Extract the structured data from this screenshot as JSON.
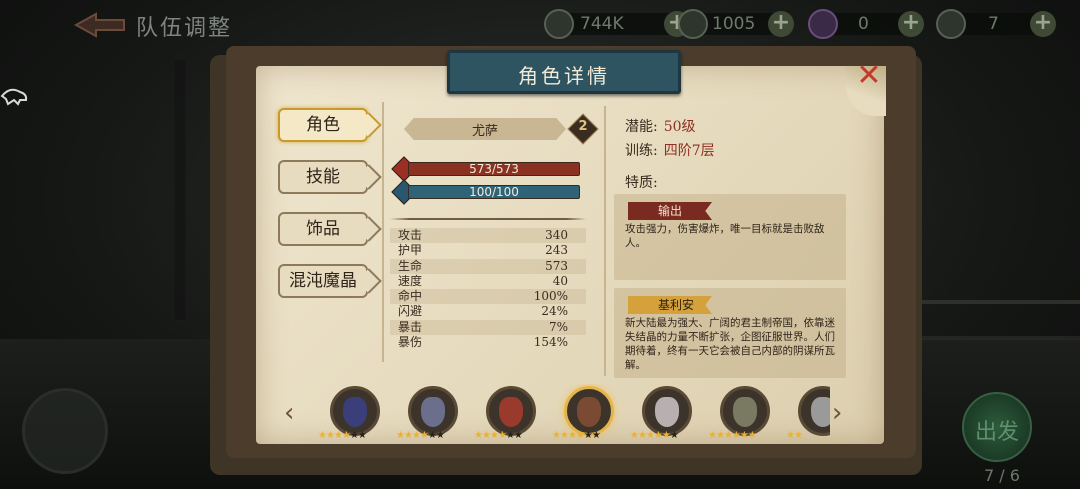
{
  "topbar": {
    "title": "队伍调整",
    "currencies": [
      {
        "icon": "gold-coin-icon",
        "value": "744K",
        "has_plus": true
      },
      {
        "icon": "diamond-icon",
        "value": "1005",
        "has_plus": true
      },
      {
        "icon": "purple-crystal-icon",
        "value": "0",
        "has_plus": true
      },
      {
        "icon": "green-emblem-icon",
        "value": "7",
        "has_plus": true
      }
    ]
  },
  "panel": {
    "title": "角色详情",
    "tabs": [
      "角色",
      "技能",
      "饰品",
      "混沌魔晶"
    ],
    "active_tab": 0
  },
  "character": {
    "name": "尤萨",
    "rank": "2",
    "hp": "573/573",
    "mp": "100/100",
    "stats": [
      {
        "label": "攻击",
        "value": "340"
      },
      {
        "label": "护甲",
        "value": "243"
      },
      {
        "label": "生命",
        "value": "573"
      },
      {
        "label": "速度",
        "value": "40"
      },
      {
        "label": "命中",
        "value": "100%"
      },
      {
        "label": "闪避",
        "value": "24%"
      },
      {
        "label": "暴击",
        "value": "7%"
      },
      {
        "label": "暴伤",
        "value": "154%"
      }
    ],
    "potential_label": "潜能:",
    "potential_value": "50级",
    "training_label": "训练:",
    "training_value": "四阶7层",
    "traits_label": "特质:",
    "trait1_tag": "输出",
    "trait1_desc": "攻击强力，伤害爆炸，唯一目标就是击败敌人。",
    "trait2_tag": "基利安",
    "trait2_desc": "新大陆最为强大、广阔的君主制帝国，依靠迷失结晶的力量不断扩张，企图征服世界。人们期待着，终有一天它会被自己内部的阴谋所瓦解。"
  },
  "heroes": [
    {
      "stars": 4,
      "max": 6,
      "color": "#3a3f7a"
    },
    {
      "stars": 4,
      "max": 6,
      "color": "#6c6f8c"
    },
    {
      "stars": 4,
      "max": 6,
      "color": "#9a3a2c"
    },
    {
      "stars": 4,
      "max": 6,
      "color": "#7a4a32",
      "selected": true
    },
    {
      "stars": 5,
      "max": 6,
      "color": "#b8b0b0"
    },
    {
      "stars": 6,
      "max": 6,
      "color": "#7a7a62"
    },
    {
      "stars": 2,
      "max": 2,
      "color": "#9a9a9a"
    }
  ],
  "colors": {
    "accent_gold": "#e3b54a",
    "close_red": "#c23a2a",
    "banner_teal": "#2f5461"
  },
  "bottom": {
    "go_label": "出发",
    "team_count": "7 / 6"
  }
}
